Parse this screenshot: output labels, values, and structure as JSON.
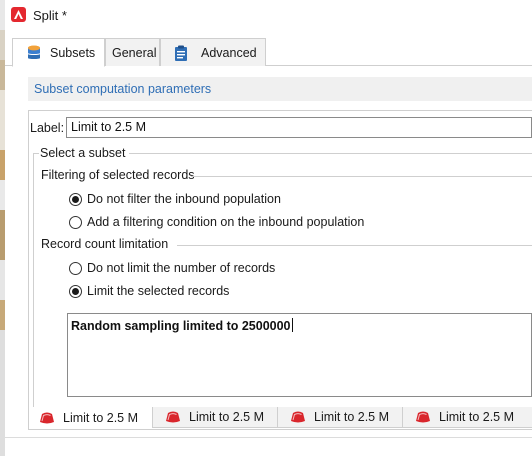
{
  "window": {
    "title": "Split *",
    "accent_color": "#e4282f",
    "link_color": "#2f6eb5"
  },
  "tabs": [
    {
      "label": "Subsets",
      "icon": "database-icon",
      "active": true
    },
    {
      "label": "General",
      "icon": "",
      "active": false
    },
    {
      "label": "Advanced",
      "icon": "clipboard-icon",
      "active": false
    }
  ],
  "section_header": "Subset computation parameters",
  "label_field": {
    "label": "Label:",
    "value": "Limit to 2.5 M"
  },
  "select_subset": {
    "title": "Select a subset",
    "filtering": {
      "title": "Filtering of selected records",
      "options": [
        {
          "label": "Do not filter the inbound population",
          "checked": true
        },
        {
          "label": "Add a filtering condition on the inbound population",
          "checked": false
        }
      ]
    },
    "limitation": {
      "title": "Record count limitation",
      "options": [
        {
          "label": "Do not limit the number of records",
          "checked": false
        },
        {
          "label": "Limit the selected records",
          "checked": true
        }
      ],
      "summary": "Random sampling limited to 2500000"
    }
  },
  "subset_tabs": [
    {
      "label": "Limit to 2.5 M",
      "icon": "subset-icon",
      "active": true
    },
    {
      "label": "Limit to 2.5 M",
      "icon": "subset-icon",
      "active": false
    },
    {
      "label": "Limit to 2.5 M",
      "icon": "subset-icon",
      "active": false
    },
    {
      "label": "Limit to 2.5 M",
      "icon": "subset-icon",
      "active": false
    }
  ]
}
